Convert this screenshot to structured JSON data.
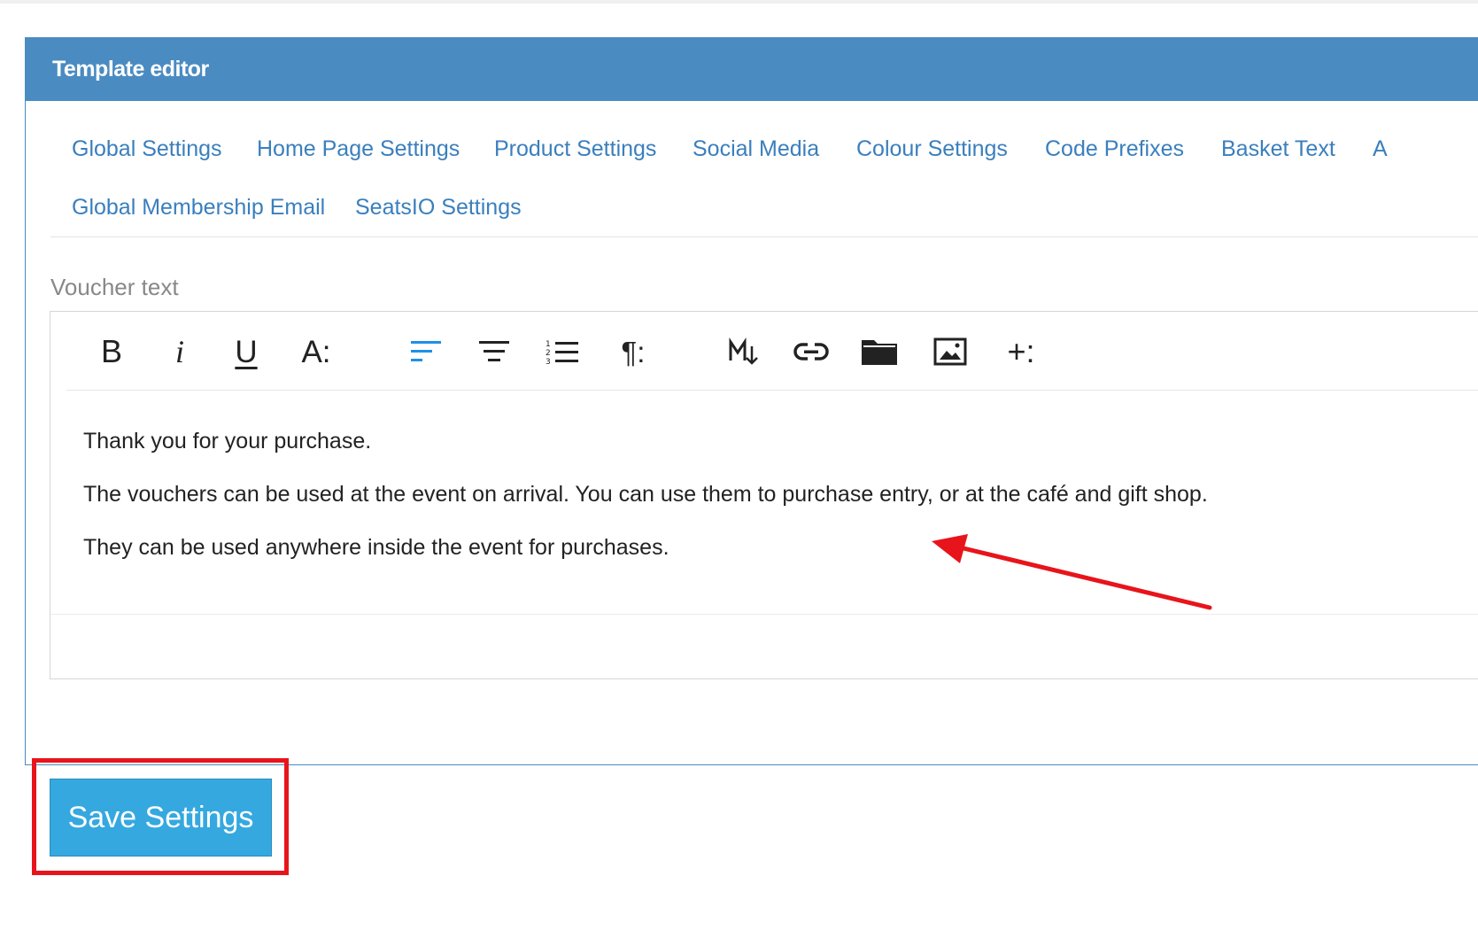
{
  "panel": {
    "title": "Template editor"
  },
  "tabs": [
    {
      "label": "Global Settings"
    },
    {
      "label": "Home Page Settings"
    },
    {
      "label": "Product Settings"
    },
    {
      "label": "Social Media"
    },
    {
      "label": "Colour Settings"
    },
    {
      "label": "Code Prefixes"
    },
    {
      "label": "Basket Text"
    },
    {
      "label": "A"
    },
    {
      "label": "Global Membership Email"
    },
    {
      "label": "SeatsIO Settings"
    }
  ],
  "field": {
    "label": "Voucher text"
  },
  "toolbar": {
    "bold": "B",
    "italic": "i",
    "underline": "U",
    "font_size": "A:",
    "paragraph": "¶:",
    "insert_more": "+:",
    "active_color": "#1e90e6"
  },
  "content": {
    "paragraphs": [
      "Thank you for your purchase.",
      "The vouchers can be used at the event on arrival. You can use them to purchase entry, or at the café and gift shop.",
      "They can be used anywhere inside the event for purchases."
    ]
  },
  "save_button": {
    "label": "Save Settings"
  },
  "colors": {
    "header": "#4a8bc2",
    "link": "#3a7fbd",
    "button": "#35a8e0",
    "annotation": "#e8141b"
  }
}
